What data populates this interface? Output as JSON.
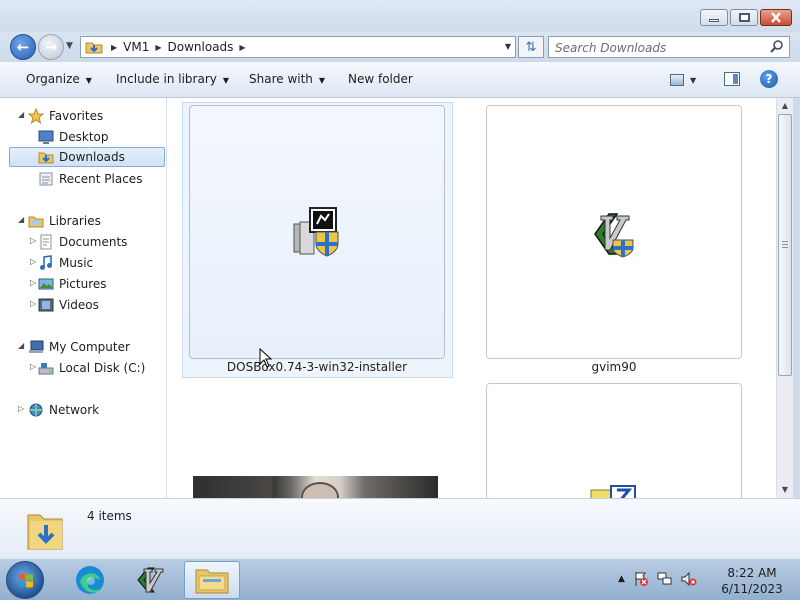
{
  "window": {
    "caption_buttons": [
      "minimize",
      "maximize",
      "close"
    ]
  },
  "address": {
    "breadcrumbs": [
      "VM1",
      "Downloads"
    ],
    "back_icon": "back-arrow-icon",
    "forward_icon": "forward-arrow-icon"
  },
  "search": {
    "placeholder": "Search Downloads"
  },
  "toolbar": {
    "organize": "Organize",
    "include_in_library": "Include in library",
    "share_with": "Share with",
    "new_folder": "New folder",
    "help": "?"
  },
  "nav": {
    "favorites": {
      "label": "Favorites",
      "items": [
        "Desktop",
        "Downloads",
        "Recent Places"
      ]
    },
    "libraries": {
      "label": "Libraries",
      "items": [
        "Documents",
        "Music",
        "Pictures",
        "Videos"
      ]
    },
    "computer": {
      "label": "My Computer",
      "items": [
        "Local Disk (C:)"
      ]
    },
    "network": {
      "label": "Network"
    },
    "selected": "Downloads"
  },
  "files": [
    {
      "name": "DOSBox0.74-3-win32-installer",
      "icon": "installer-icon",
      "selected": true
    },
    {
      "name": "gvim90",
      "icon": "vim-installer-icon",
      "selected": false
    },
    {
      "name": "",
      "icon": "photo-thumbnail",
      "selected": false
    },
    {
      "name": "",
      "icon": "7zip-installer-icon",
      "selected": false
    }
  ],
  "details": {
    "count_text": "4 items"
  },
  "taskbar": {
    "apps": [
      "edge-icon",
      "vim-icon",
      "explorer-icon"
    ],
    "active_app": "explorer-icon",
    "clock_time": "8:22 AM",
    "clock_date": "6/11/2023"
  },
  "colors": {
    "selection": "#cfe2f7",
    "taskbar": "#93afcf",
    "close_button": "#c74a32"
  }
}
